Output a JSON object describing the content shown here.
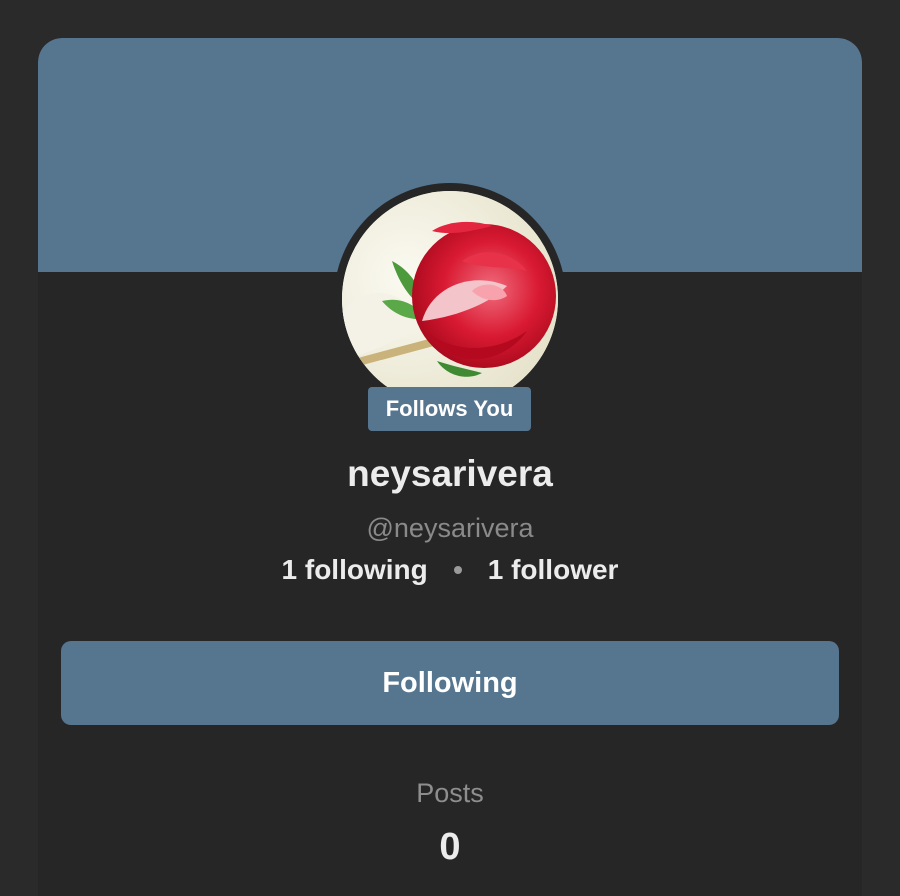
{
  "colors": {
    "accent": "#56758f",
    "background": "#2a2a2b",
    "card": "#262627"
  },
  "profile": {
    "avatar_icon": "rose-avatar",
    "follows_badge": "Follows You",
    "display_name": "neysarivera",
    "handle": "@neysarivera",
    "following_text": "1 following",
    "follower_text": "1 follower"
  },
  "actions": {
    "follow_button_label": "Following"
  },
  "posts": {
    "label": "Posts",
    "count": "0"
  }
}
